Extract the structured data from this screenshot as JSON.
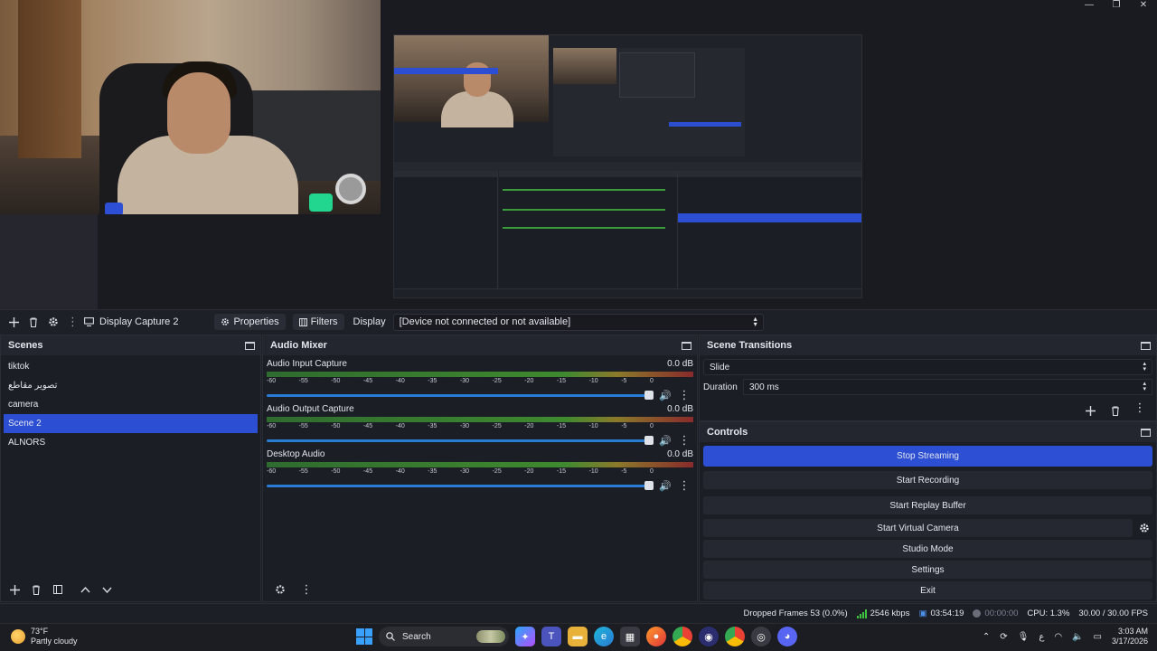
{
  "window": {
    "minimize": "—",
    "maximize": "❐",
    "close": "✕"
  },
  "source_bar": {
    "source_name": "Display Capture 2",
    "properties_label": "Properties",
    "filters_label": "Filters",
    "display_label": "Display",
    "display_value": "[Device not connected or not available]"
  },
  "scenes": {
    "title": "Scenes",
    "items": [
      "tiktok",
      "تصوير مقاطع",
      "camera",
      "Scene 2",
      "ALNORS"
    ],
    "active": "Scene 2"
  },
  "mixer": {
    "title": "Audio Mixer",
    "ticks": [
      "-60",
      "-55",
      "-50",
      "-45",
      "-40",
      "-35",
      "-30",
      "-25",
      "-20",
      "-15",
      "-10",
      "-5",
      "0"
    ],
    "channels": [
      {
        "name": "Audio Input Capture",
        "db": "0.0 dB"
      },
      {
        "name": "Audio Output Capture",
        "db": "0.0 dB"
      },
      {
        "name": "Desktop Audio",
        "db": "0.0 dB"
      }
    ]
  },
  "transitions": {
    "title": "Scene Transitions",
    "transition": "Slide",
    "duration_label": "Duration",
    "duration_value": "300 ms"
  },
  "controls": {
    "title": "Controls",
    "stop_streaming": "Stop Streaming",
    "start_recording": "Start Recording",
    "start_replay_buffer": "Start Replay Buffer",
    "start_virtual_camera": "Start Virtual Camera",
    "studio_mode": "Studio Mode",
    "settings": "Settings",
    "exit": "Exit"
  },
  "status": {
    "dropped_frames": "Dropped Frames 53 (0.0%)",
    "bitrate": "2546 kbps",
    "stream_time": "03:54:19",
    "record_time": "00:00:00",
    "cpu": "CPU: 1.3%",
    "fps": "30.00 / 30.00 FPS"
  },
  "taskbar": {
    "temperature": "73°F",
    "weather": "Partly cloudy",
    "search_placeholder": "Search",
    "time": "3:03 AM",
    "date": "3/17/2026"
  },
  "colors": {
    "accent": "#2c4fd3",
    "panel": "#1c1e26",
    "header": "#24262f",
    "meter_green": "#3f8a2f"
  }
}
